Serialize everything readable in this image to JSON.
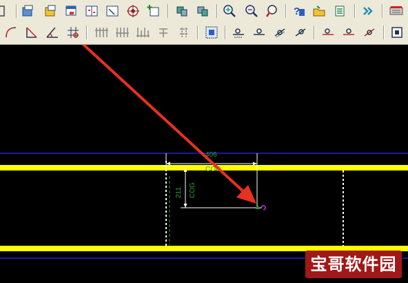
{
  "toolbar_top": {
    "icons": [
      "toolbar-stub-icon",
      "open-model-icon",
      "save-model-icon",
      "window-icon",
      "split-view-icon",
      "frame-view-icon",
      "target-icon",
      "add-view-icon",
      "reload-left-icon",
      "reload-right-icon",
      "zoom-in-icon",
      "zoom-out-icon",
      "zoom-window-icon",
      "help-icon",
      "open-folder-icon",
      "list-icon",
      "forward-icon",
      "keyboard-icon"
    ]
  },
  "toolbar_bottom": {
    "icons": [
      "arc-icon",
      "angle-icon",
      "angle-dimension-icon",
      "grid-point-icon",
      "grid-lines-icon",
      "grid-lines-alt-icon",
      "grid-lines-split-icon",
      "grid-tee-icon",
      "grid-dashed-icon",
      "select-box-icon",
      "point-left-icon",
      "point-center-icon",
      "point-diagonal-icon",
      "point-diagonal-alt-icon",
      "point-red-left-icon",
      "point-red-center-icon",
      "point-red-diagonal-icon",
      "settings-box-icon"
    ]
  },
  "drawing": {
    "dimension_horizontal": "406",
    "dimension_vertical": "211",
    "label_cog_horizontal": "COG",
    "label_cog_vertical": "COG",
    "colors": {
      "background": "#000000",
      "beam": "#ffff00",
      "edge": "#1a1aa0",
      "dimension_text": "#2e9e3a",
      "dimension_line": "#ffffff",
      "cog_symbol": "#cc33cc",
      "arrow": "#e8311f"
    }
  },
  "watermark": {
    "text": "宝哥软件园",
    "color": "#a11818"
  }
}
